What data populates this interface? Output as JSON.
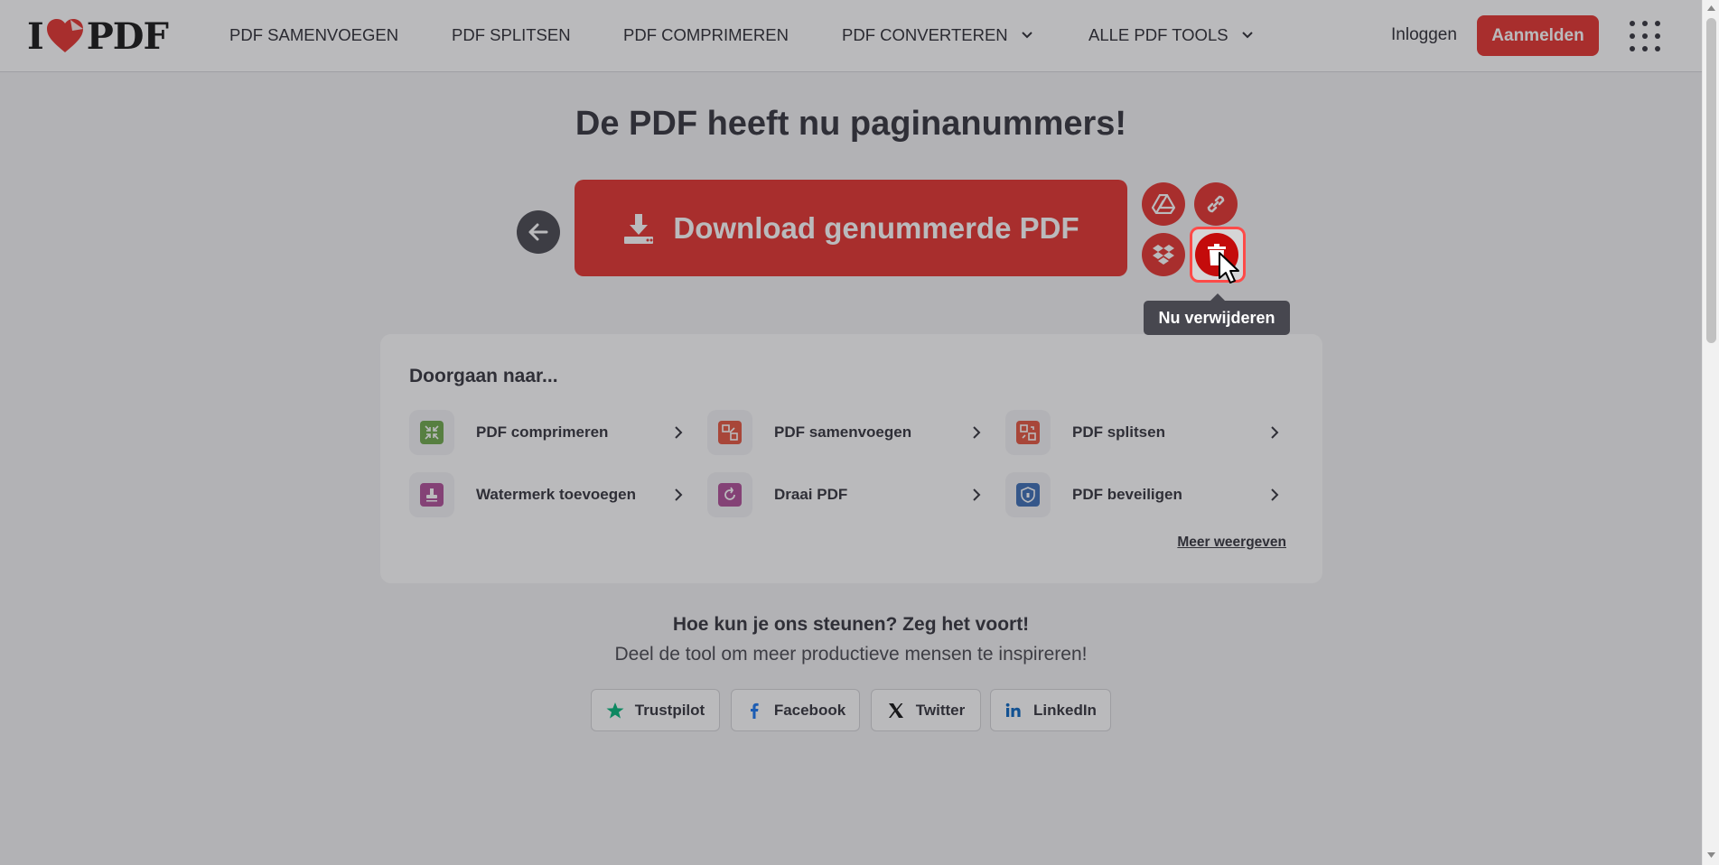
{
  "header": {
    "logo_left": "I",
    "logo_right": "PDF",
    "nav": [
      {
        "label": "PDF SAMENVOEGEN"
      },
      {
        "label": "PDF SPLITSEN"
      },
      {
        "label": "PDF COMPRIMEREN"
      },
      {
        "label": "PDF CONVERTEREN",
        "has_dropdown": true
      },
      {
        "label": "ALLE PDF TOOLS",
        "has_dropdown": true
      }
    ],
    "login_label": "Inloggen",
    "signup_label": "Aanmelden"
  },
  "main": {
    "title": "De PDF heeft nu paginanummers!",
    "download_label": "Download genummerde PDF",
    "tooltip": "Nu verwijderen",
    "actions": [
      "google-drive-icon",
      "link-icon",
      "dropbox-icon",
      "trash-icon"
    ]
  },
  "continue": {
    "title": "Doorgaan naar...",
    "tools": [
      {
        "label": "PDF comprimeren",
        "color": "#6ea94b"
      },
      {
        "label": "PDF samenvoegen",
        "color": "#e5553f"
      },
      {
        "label": "PDF splitsen",
        "color": "#e5553f"
      },
      {
        "label": "Watermerk toevoegen",
        "color": "#b04f98"
      },
      {
        "label": "Draai PDF",
        "color": "#b04f98"
      },
      {
        "label": "PDF beveiligen",
        "color": "#3b6eb5"
      }
    ],
    "more_label": "Meer weergeven"
  },
  "support": {
    "heading": "Hoe kun je ons steunen? Zeg het voort!",
    "text": "Deel de tool om meer productieve mensen te inspireren!",
    "buttons": [
      {
        "label": "Trustpilot",
        "icon": "trustpilot-star-icon"
      },
      {
        "label": "Facebook",
        "icon": "facebook-icon"
      },
      {
        "label": "Twitter",
        "icon": "x-twitter-icon"
      },
      {
        "label": "LinkedIn",
        "icon": "linkedin-icon"
      }
    ]
  },
  "colors": {
    "brand": "#e5322d",
    "dark": "#47474f"
  }
}
